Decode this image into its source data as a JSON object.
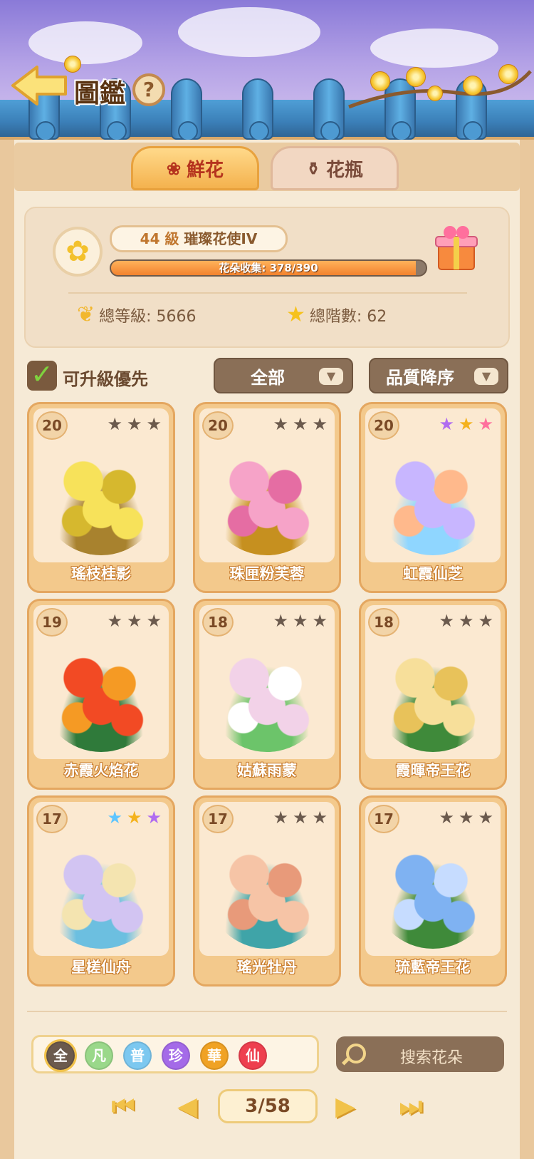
{
  "header": {
    "title": "圖鑑",
    "help_symbol": "?"
  },
  "tabs": [
    {
      "label": "鮮花",
      "icon": "rose-icon",
      "active": true
    },
    {
      "label": "花瓶",
      "icon": "vase-icon",
      "active": false
    }
  ],
  "stats": {
    "level_label": "44 級",
    "rank_title": "璀璨花使IV",
    "collection_text": "花朵收集: 378/390",
    "collection_progress": 0.969,
    "total_level_label": "總等級: 5666",
    "total_rank_label": "總階數: 62"
  },
  "filters": {
    "upgrade_first_label": "可升級優先",
    "category_label": "全部",
    "sort_label": "品質降序"
  },
  "cards": [
    {
      "level": "20",
      "name": "瑤枝桂影",
      "stars": [
        "#6b5a4d",
        "#6b5a4d",
        "#6b5a4d"
      ],
      "art_colors": [
        "#f7e25a",
        "#d6b82e",
        "#a8822e"
      ]
    },
    {
      "level": "20",
      "name": "珠匣粉芙蓉",
      "stars": [
        "#6b5a4d",
        "#6b5a4d",
        "#6b5a4d"
      ],
      "art_colors": [
        "#f6a3c8",
        "#e56da3",
        "#c6901f"
      ]
    },
    {
      "level": "20",
      "name": "虹霞仙芝",
      "stars": [
        "#b06cf0",
        "#f4b21c",
        "#ff6f9d"
      ],
      "art_colors": [
        "#c8b6ff",
        "#ffb98c",
        "#8fd6ff"
      ]
    },
    {
      "level": "19",
      "name": "赤霞火焰花",
      "stars": [
        "#6b5a4d",
        "#6b5a4d",
        "#6b5a4d"
      ],
      "art_colors": [
        "#f24a24",
        "#f59a24",
        "#2f7a3a"
      ]
    },
    {
      "level": "18",
      "name": "姑蘇雨蒙",
      "stars": [
        "#6b5a4d",
        "#6b5a4d",
        "#6b5a4d"
      ],
      "art_colors": [
        "#f2d2e8",
        "#ffffff",
        "#6cc46a"
      ]
    },
    {
      "level": "18",
      "name": "霞暉帝王花",
      "stars": [
        "#6b5a4d",
        "#6b5a4d",
        "#6b5a4d"
      ],
      "art_colors": [
        "#f7df9a",
        "#e8c25a",
        "#3f8a3a"
      ]
    },
    {
      "level": "17",
      "name": "星槎仙舟",
      "stars": [
        "#5ec5ff",
        "#f4b21c",
        "#b06cf0"
      ],
      "art_colors": [
        "#d2c4f2",
        "#f4e4b0",
        "#6cbfe0"
      ]
    },
    {
      "level": "17",
      "name": "瑤光牡丹",
      "stars": [
        "#6b5a4d",
        "#6b5a4d",
        "#6b5a4d"
      ],
      "art_colors": [
        "#f6c4a6",
        "#e89a7a",
        "#3fa4a8"
      ]
    },
    {
      "level": "17",
      "name": "琉藍帝王花",
      "stars": [
        "#6b5a4d",
        "#6b5a4d",
        "#6b5a4d"
      ],
      "art_colors": [
        "#7fb2f2",
        "#c6dcff",
        "#3f8a3a"
      ]
    }
  ],
  "rarity_filters": [
    {
      "label": "全",
      "color": "#6b5a4d",
      "selected": true
    },
    {
      "label": "凡",
      "color": "#9ad88a",
      "selected": false
    },
    {
      "label": "普",
      "color": "#7cc8f0",
      "selected": false
    },
    {
      "label": "珍",
      "color": "#a46ae8",
      "selected": false
    },
    {
      "label": "華",
      "color": "#f0a224",
      "selected": false
    },
    {
      "label": "仙",
      "color": "#ee3f4e",
      "selected": false
    }
  ],
  "search": {
    "placeholder": "搜索花朵"
  },
  "pager": {
    "page_text": "3/58",
    "first_symbol": "⏮",
    "prev_symbol": "◀",
    "next_symbol": "▶",
    "last_symbol": "⏭"
  }
}
